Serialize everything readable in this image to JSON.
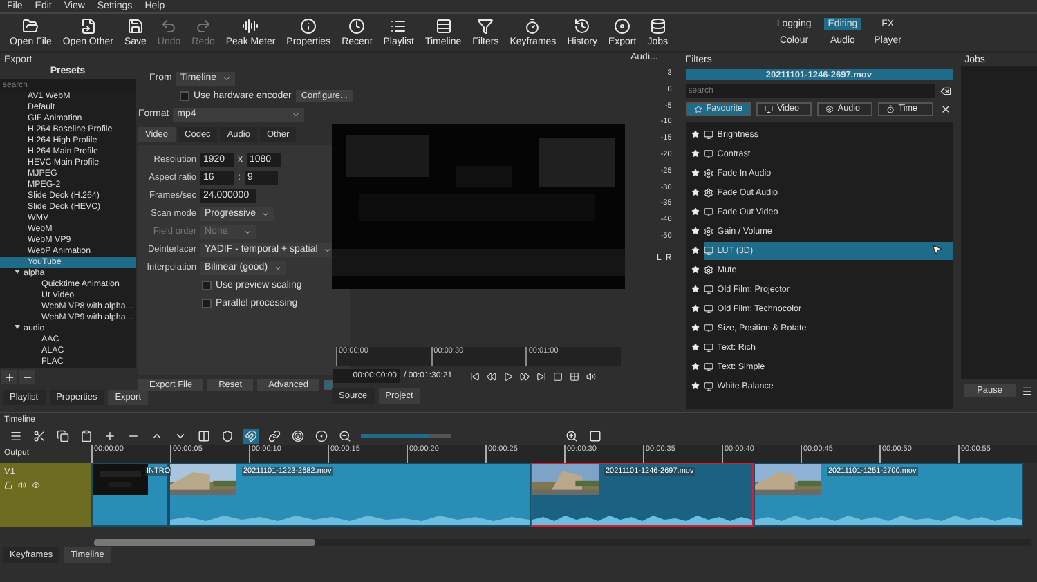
{
  "menu": [
    "File",
    "Edit",
    "View",
    "Settings",
    "Help"
  ],
  "toolbar": [
    {
      "label": "Open File",
      "disabled": false
    },
    {
      "label": "Open Other",
      "disabled": false
    },
    {
      "label": "Save",
      "disabled": false
    },
    {
      "label": "Undo",
      "disabled": true
    },
    {
      "label": "Redo",
      "disabled": true
    },
    {
      "label": "Peak Meter",
      "disabled": false
    },
    {
      "label": "Properties",
      "disabled": false
    },
    {
      "label": "Recent",
      "disabled": false
    },
    {
      "label": "Playlist",
      "disabled": false
    },
    {
      "label": "Timeline",
      "disabled": false
    },
    {
      "label": "Filters",
      "disabled": false
    },
    {
      "label": "Keyframes",
      "disabled": false
    },
    {
      "label": "History",
      "disabled": false
    },
    {
      "label": "Export",
      "disabled": false
    },
    {
      "label": "Jobs",
      "disabled": false
    }
  ],
  "layouts": [
    [
      {
        "label": "Logging",
        "selected": false
      },
      {
        "label": "Editing",
        "selected": true
      },
      {
        "label": "FX",
        "selected": false
      }
    ],
    [
      {
        "label": "Colour",
        "selected": false
      },
      {
        "label": "Audio",
        "selected": false
      },
      {
        "label": "Player",
        "selected": false
      }
    ]
  ],
  "export": {
    "title": "Export",
    "presets_title": "Presets",
    "search": {
      "placeholder": "search"
    },
    "presets": [
      {
        "label": "AV1 WebM",
        "selected": false
      },
      {
        "label": "Default",
        "selected": false
      },
      {
        "label": "GIF Animation",
        "selected": false
      },
      {
        "label": "H.264 Baseline Profile",
        "selected": false
      },
      {
        "label": "H.264 High Profile",
        "selected": false
      },
      {
        "label": "H.264 Main Profile",
        "selected": false
      },
      {
        "label": "HEVC Main Profile",
        "selected": false
      },
      {
        "label": "MJPEG",
        "selected": false
      },
      {
        "label": "MPEG-2",
        "selected": false
      },
      {
        "label": "Slide Deck (H.264)",
        "selected": false
      },
      {
        "label": "Slide Deck (HEVC)",
        "selected": false
      },
      {
        "label": "WMV",
        "selected": false
      },
      {
        "label": "WebM",
        "selected": false
      },
      {
        "label": "WebM VP9",
        "selected": false
      },
      {
        "label": "WebP Animation",
        "selected": false
      },
      {
        "label": "YouTube",
        "selected": true
      },
      {
        "label": "alpha",
        "selected": false,
        "expanded": true,
        "children": [
          {
            "label": "Quicktime Animation",
            "selected": false
          },
          {
            "label": "Ut Video",
            "selected": false
          },
          {
            "label": "WebM VP8 with alpha...",
            "selected": false
          },
          {
            "label": "WebM VP9 with alpha...",
            "selected": false
          }
        ]
      },
      {
        "label": "audio",
        "selected": false,
        "expanded": true,
        "children": [
          {
            "label": "AAC",
            "selected": false
          },
          {
            "label": "ALAC",
            "selected": false
          },
          {
            "label": "FLAC",
            "selected": false
          }
        ]
      }
    ],
    "from": {
      "label": "From",
      "value": "Timeline"
    },
    "hardware": {
      "label": "Use hardware encoder",
      "checked": false
    },
    "configure": "Configure...",
    "format": {
      "label": "Format",
      "value": "mp4"
    },
    "tabs": [
      {
        "label": "Video",
        "selected": true
      },
      {
        "label": "Codec",
        "selected": false
      },
      {
        "label": "Audio",
        "selected": false
      },
      {
        "label": "Other",
        "selected": false
      }
    ],
    "fields": [
      {
        "kind": "pair",
        "label": "Resolution",
        "value": "1920",
        "separator": "x",
        "value2": "1080",
        "disabled": false
      },
      {
        "kind": "pair",
        "label": "Aspect ratio",
        "value": "16",
        "separator": ":",
        "value2": "9",
        "disabled": false
      },
      {
        "kind": "spin",
        "label": "Frames/sec",
        "value": "24.000000",
        "disabled": false
      },
      {
        "kind": "select",
        "label": "Scan mode",
        "value": "Progressive",
        "disabled": false
      },
      {
        "kind": "select",
        "label": "Field order",
        "value": "None",
        "disabled": true
      },
      {
        "kind": "select",
        "label": "Deinterlacer",
        "value": "YADIF - temporal + spatial",
        "disabled": false
      },
      {
        "kind": "select",
        "label": "Interpolation",
        "value": "Bilinear (good)",
        "disabled": false
      }
    ],
    "options": [
      {
        "label": "Use preview scaling",
        "checked": false
      },
      {
        "label": "Parallel processing",
        "checked": false
      }
    ],
    "buttons": [
      "Export File",
      "Reset",
      "Advanced"
    ],
    "advanced_checked": true
  },
  "left_tabs": [
    {
      "label": "Playlist",
      "selected": false
    },
    {
      "label": "Properties",
      "selected": false
    },
    {
      "label": "Export",
      "selected": true
    }
  ],
  "player": {
    "ruler": [
      "00:00:00",
      "00:00:30",
      "00:01:00"
    ],
    "timecode": "00:00:00:00",
    "duration": "/ 00:01:30:21",
    "tabs": [
      {
        "label": "Source",
        "selected": false
      },
      {
        "label": "Project",
        "selected": true
      }
    ]
  },
  "audio_meter": {
    "title": "Audi...",
    "scale": [
      "3",
      "0",
      "-5",
      "-10",
      "-15",
      "-20",
      "-25",
      "-30",
      "-35",
      "-40",
      "-50"
    ],
    "channels": "L  R"
  },
  "filters": {
    "title": "Filters",
    "clip": "20211101-1246-2697.mov",
    "search": {
      "placeholder": "search"
    },
    "categories": [
      {
        "label": "Favourite",
        "selected": true
      },
      {
        "label": "Video",
        "selected": false
      },
      {
        "label": "Audio",
        "selected": false
      },
      {
        "label": "Time",
        "selected": false
      }
    ],
    "items": [
      {
        "label": "Brightness",
        "kind": "video",
        "selected": false
      },
      {
        "label": "Contrast",
        "kind": "video",
        "selected": false
      },
      {
        "label": "Fade In Audio",
        "kind": "audio",
        "selected": false
      },
      {
        "label": "Fade Out Audio",
        "kind": "audio",
        "selected": false
      },
      {
        "label": "Fade Out Video",
        "kind": "video",
        "selected": false
      },
      {
        "label": "Gain / Volume",
        "kind": "audio",
        "selected": false
      },
      {
        "label": "LUT (3D)",
        "kind": "video",
        "selected": true
      },
      {
        "label": "Mute",
        "kind": "audio",
        "selected": false
      },
      {
        "label": "Old Film: Projector",
        "kind": "video",
        "selected": false
      },
      {
        "label": "Old Film: Technocolor",
        "kind": "video",
        "selected": false
      },
      {
        "label": "Size, Position & Rotate",
        "kind": "video",
        "selected": false
      },
      {
        "label": "Text: Rich",
        "kind": "video",
        "selected": false
      },
      {
        "label": "Text: Simple",
        "kind": "video",
        "selected": false
      },
      {
        "label": "White Balance",
        "kind": "video",
        "selected": false
      }
    ]
  },
  "jobs": {
    "title": "Jobs",
    "button": "Pause"
  },
  "timeline": {
    "title": "Timeline",
    "snapping": true,
    "zoom": {
      "level": 0.75
    },
    "output": "Output",
    "ruler": [
      "00:00:00",
      "00:00:05",
      "00:00:10",
      "00:00:15",
      "00:00:20",
      "00:00:25",
      "00:00:30",
      "00:00:35",
      "00:00:40",
      "00:00:45",
      "00:00:50",
      "00:00:55"
    ],
    "track": {
      "name": "V1"
    },
    "clips": [
      {
        "label": "INTRO",
        "selected": false
      },
      {
        "label": "20211101-1223-2682.mov",
        "selected": false
      },
      {
        "label": "20211101-1246-2697.mov",
        "selected": true
      },
      {
        "label": "20211101-1251-2700.mov",
        "selected": false
      }
    ]
  },
  "bottom_tabs": [
    {
      "label": "Keyframes",
      "selected": false
    },
    {
      "label": "Timeline",
      "selected": true
    }
  ]
}
